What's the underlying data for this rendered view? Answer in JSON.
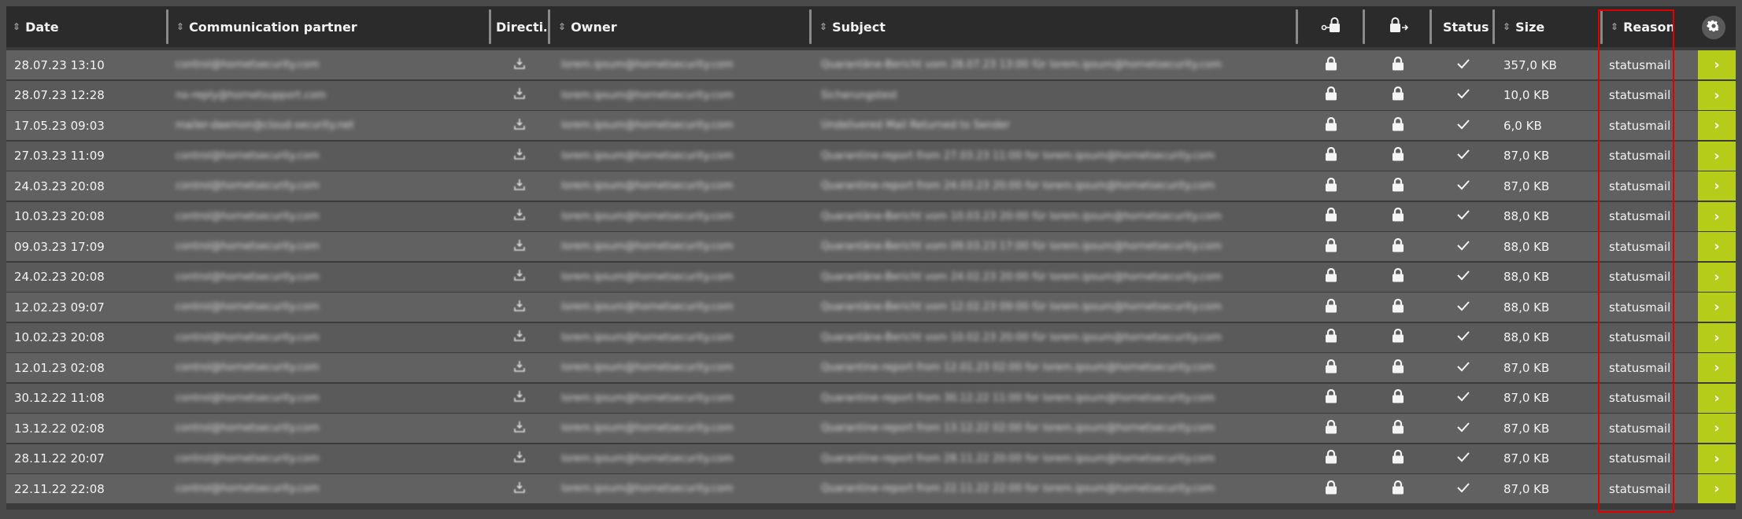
{
  "header": {
    "columns": [
      {
        "key": "date",
        "label": "Date",
        "sortable": true
      },
      {
        "key": "partner",
        "label": "Communication partner",
        "sortable": true
      },
      {
        "key": "direction",
        "label": "Directi…",
        "sortable": false
      },
      {
        "key": "owner",
        "label": "Owner",
        "sortable": true
      },
      {
        "key": "subject",
        "label": "Subject",
        "sortable": true
      },
      {
        "key": "encrypted_icon",
        "label": "",
        "icon": "lock-key-icon"
      },
      {
        "key": "signed_icon",
        "label": "",
        "icon": "lock-arrow-icon"
      },
      {
        "key": "status",
        "label": "Status",
        "sortable": false
      },
      {
        "key": "size",
        "label": "Size",
        "sortable": true
      },
      {
        "key": "reason",
        "label": "Reason",
        "sortable": true
      }
    ],
    "settings_icon": "gear-icon"
  },
  "rows": [
    {
      "date": "28.07.23 13:10",
      "partner": "control@hornetsecurity.com",
      "owner": "lorem.ipsum@hornetsecurity.com",
      "subject": "Quarantäne-Bericht vom 28.07.23 13:00 für lorem.ipsum@hornetsecurity.com",
      "size": "357,0 KB",
      "reason": "statusmail"
    },
    {
      "date": "28.07.23 12:28",
      "partner": "no-reply@hornetsupport.com",
      "owner": "lorem.ipsum@hornetsecurity.com",
      "subject": "Sicherungstest",
      "size": "10,0 KB",
      "reason": "statusmail"
    },
    {
      "date": "17.05.23 09:03",
      "partner": "mailer-daemon@cloud-security.net",
      "owner": "lorem.ipsum@hornetsecurity.com",
      "subject": "Undelivered Mail Returned to Sender",
      "size": "6,0 KB",
      "reason": "statusmail"
    },
    {
      "date": "27.03.23 11:09",
      "partner": "control@hornetsecurity.com",
      "owner": "lorem.ipsum@hornetsecurity.com",
      "subject": "Quarantine-report from 27.03.23 11:00 for lorem.ipsum@hornetsecurity.com",
      "size": "87,0 KB",
      "reason": "statusmail"
    },
    {
      "date": "24.03.23 20:08",
      "partner": "control@hornetsecurity.com",
      "owner": "lorem.ipsum@hornetsecurity.com",
      "subject": "Quarantine-report from 24.03.23 20:00 for lorem.ipsum@hornetsecurity.com",
      "size": "87,0 KB",
      "reason": "statusmail"
    },
    {
      "date": "10.03.23 20:08",
      "partner": "control@hornetsecurity.com",
      "owner": "lorem.ipsum@hornetsecurity.com",
      "subject": "Quarantäne-Bericht vom 10.03.23 20:00 für lorem.ipsum@hornetsecurity.com",
      "size": "88,0 KB",
      "reason": "statusmail"
    },
    {
      "date": "09.03.23 17:09",
      "partner": "control@hornetsecurity.com",
      "owner": "lorem.ipsum@hornetsecurity.com",
      "subject": "Quarantäne-Bericht vom 09.03.23 17:00 für lorem.ipsum@hornetsecurity.com",
      "size": "88,0 KB",
      "reason": "statusmail"
    },
    {
      "date": "24.02.23 20:08",
      "partner": "control@hornetsecurity.com",
      "owner": "lorem.ipsum@hornetsecurity.com",
      "subject": "Quarantäne-Bericht vom 24.02.23 20:00 für lorem.ipsum@hornetsecurity.com",
      "size": "88,0 KB",
      "reason": "statusmail"
    },
    {
      "date": "12.02.23 09:07",
      "partner": "control@hornetsecurity.com",
      "owner": "lorem.ipsum@hornetsecurity.com",
      "subject": "Quarantäne-Bericht vom 12.02.23 09:00 für lorem.ipsum@hornetsecurity.com",
      "size": "88,0 KB",
      "reason": "statusmail"
    },
    {
      "date": "10.02.23 20:08",
      "partner": "control@hornetsecurity.com",
      "owner": "lorem.ipsum@hornetsecurity.com",
      "subject": "Quarantäne-Bericht vom 10.02.23 20:00 für lorem.ipsum@hornetsecurity.com",
      "size": "88,0 KB",
      "reason": "statusmail"
    },
    {
      "date": "12.01.23 02:08",
      "partner": "control@hornetsecurity.com",
      "owner": "lorem.ipsum@hornetsecurity.com",
      "subject": "Quarantine-report from 12.01.23 02:00 for lorem.ipsum@hornetsecurity.com",
      "size": "87,0 KB",
      "reason": "statusmail"
    },
    {
      "date": "30.12.22 11:08",
      "partner": "control@hornetsecurity.com",
      "owner": "lorem.ipsum@hornetsecurity.com",
      "subject": "Quarantine-report from 30.12.22 11:00 for lorem.ipsum@hornetsecurity.com",
      "size": "87,0 KB",
      "reason": "statusmail"
    },
    {
      "date": "13.12.22 02:08",
      "partner": "control@hornetsecurity.com",
      "owner": "lorem.ipsum@hornetsecurity.com",
      "subject": "Quarantine-report from 13.12.22 02:00 for lorem.ipsum@hornetsecurity.com",
      "size": "87,0 KB",
      "reason": "statusmail"
    },
    {
      "date": "28.11.22 20:07",
      "partner": "control@hornetsecurity.com",
      "owner": "lorem.ipsum@hornetsecurity.com",
      "subject": "Quarantine-report from 28.11.22 20:00 for lorem.ipsum@hornetsecurity.com",
      "size": "87,0 KB",
      "reason": "statusmail"
    },
    {
      "date": "22.11.22 22:08",
      "partner": "control@hornetsecurity.com",
      "owner": "lorem.ipsum@hornetsecurity.com",
      "subject": "Quarantine-report from 22.11.22 22:00 for lorem.ipsum@hornetsecurity.com",
      "size": "87,0 KB",
      "reason": "statusmail"
    }
  ],
  "row_icons": {
    "direction": "inbound-tray-icon",
    "encrypted": "lock-icon",
    "signed": "lock-icon",
    "status": "check-icon",
    "action": "chevron-right-icon"
  },
  "colors": {
    "accent": "#b5cc18",
    "highlight": "#e00000",
    "header_bg": "#2b2b2b"
  }
}
